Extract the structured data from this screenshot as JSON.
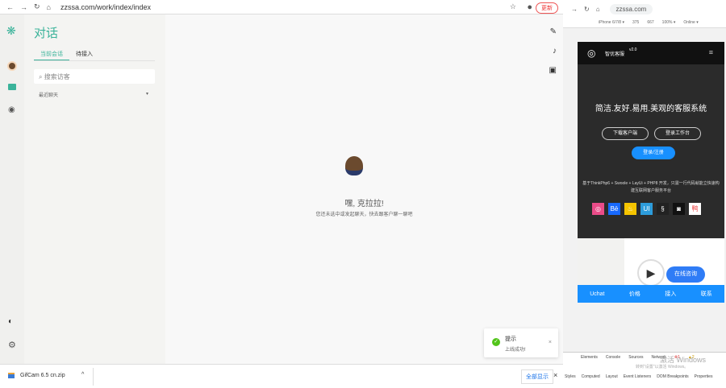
{
  "browser": {
    "url": "zzssa.com/work/index/index",
    "update_label": "更新"
  },
  "app": {
    "title": "对话",
    "tabs": [
      "当前会话",
      "待接入"
    ],
    "search_placeholder": "搜索访客",
    "recent_label": "最近聊天",
    "empty": {
      "greeting": "嘿, 克拉拉!",
      "hint": "您还未选中或发起聊天，快去跟客户聊一聊吧"
    }
  },
  "toast": {
    "title": "提示",
    "message": "上线成功!"
  },
  "download": {
    "file": "GifCam 6.5 cn.zip",
    "show_all": "全部显示"
  },
  "preview": {
    "url": "zzssa.com",
    "device": "iPhone 6/7/8 ▾",
    "width": "375",
    "height": "667",
    "zoom": "100% ▾",
    "network": "Online ▾",
    "brand": "智优客服",
    "version": "v2.0",
    "headline": "简洁.友好.易用.美观的客服系统",
    "buttons": [
      "下载客户端",
      "登录工作台",
      "登录/注册"
    ],
    "desc": "基于ThinkPhp6 + Swoole + LayUi + PHP8 开发，只需一行代码就能立快速构建互联网客户服务平台",
    "consult": "在线咨询",
    "nav": [
      "Uchat",
      "价格",
      "接入",
      "联系"
    ]
  },
  "devtools": {
    "tabs": [
      "Elements",
      "Console",
      "Sources",
      "Network"
    ],
    "errors": "1",
    "warnings": "2",
    "subtabs": [
      "Styles",
      "Computed",
      "Layout",
      "Event Listeners",
      "DOM Breakpoints",
      "Properties"
    ],
    "watermark": "激活 Windows",
    "watermark_sub": "转到\"设置\"以激活 Windows。"
  }
}
